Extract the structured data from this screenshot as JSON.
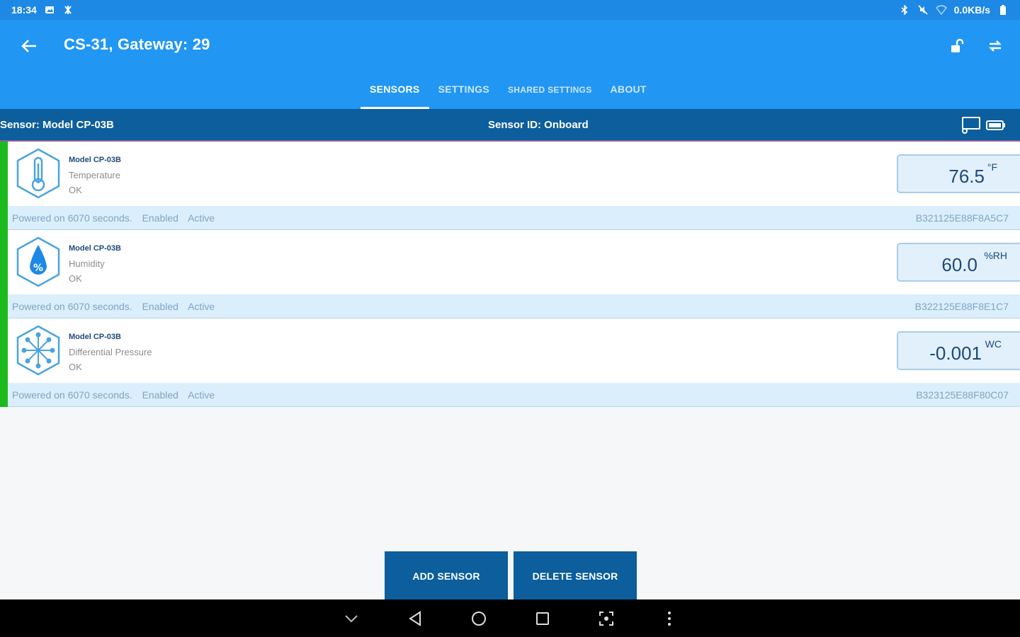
{
  "status_bar": {
    "time": "18:34",
    "network_speed": "0.0KB/s",
    "icons_left": [
      "image-icon",
      "notification-icon"
    ],
    "icons_right": [
      "bluetooth-icon",
      "mute-icon",
      "wifi-icon",
      "battery-icon"
    ]
  },
  "app_bar": {
    "title": "CS-31, Gateway: 29",
    "back_icon": "arrow-left-icon",
    "actions": [
      "unlock-icon",
      "sync-icon"
    ]
  },
  "tabs": [
    {
      "label": "SENSORS",
      "active": true
    },
    {
      "label": "SETTINGS",
      "active": false
    },
    {
      "label": "SHARED SETTINGS",
      "active": false
    },
    {
      "label": "ABOUT",
      "active": false
    }
  ],
  "sensor_bar": {
    "model": "Sensor: Model CP-03B",
    "sensor_id": "Sensor ID: Onboard",
    "icons": [
      "cast-icon",
      "battery-icon"
    ]
  },
  "sensors": [
    {
      "icon": "thermometer-icon",
      "model": "Model CP-03B",
      "type": "Temperature",
      "status": "OK",
      "value": "76.5",
      "unit": "°F",
      "powered": "Powered on 6070 seconds.",
      "enabled": "Enabled",
      "active": "Active",
      "hw_id": "B321125E88F8A5C7",
      "indicator_color": "#1cba1c"
    },
    {
      "icon": "humidity-drop-icon",
      "model": "Model CP-03B",
      "type": "Humidity",
      "status": "OK",
      "value": "60.0",
      "unit": "%RH",
      "powered": "Powered on 6070 seconds.",
      "enabled": "Enabled",
      "active": "Active",
      "hw_id": "B322125E88F8E1C7",
      "indicator_color": "#1cba1c"
    },
    {
      "icon": "pressure-burst-icon",
      "model": "Model CP-03B",
      "type": "Differential Pressure",
      "status": "OK",
      "value": "-0.001",
      "unit": "WC",
      "powered": "Powered on 6070 seconds.",
      "enabled": "Enabled",
      "active": "Active",
      "hw_id": "B323125E88F80C07",
      "indicator_color": "#1cba1c"
    }
  ],
  "buttons": {
    "add": "ADD SENSOR",
    "delete": "DELETE SENSOR"
  },
  "nav_bar": [
    "chevron-down-icon",
    "back-triangle-icon",
    "home-circle-icon",
    "recents-square-icon",
    "screenshot-icon",
    "more-vert-icon"
  ],
  "colors": {
    "status_bar": "#1e88e5",
    "app_bar": "#2196f3",
    "sensor_bar": "#0c5e9c",
    "indicator": "#1cba1c",
    "footer_row": "#dbeefb",
    "value_box": "#e1f0fb",
    "button": "#0c5e9c"
  }
}
